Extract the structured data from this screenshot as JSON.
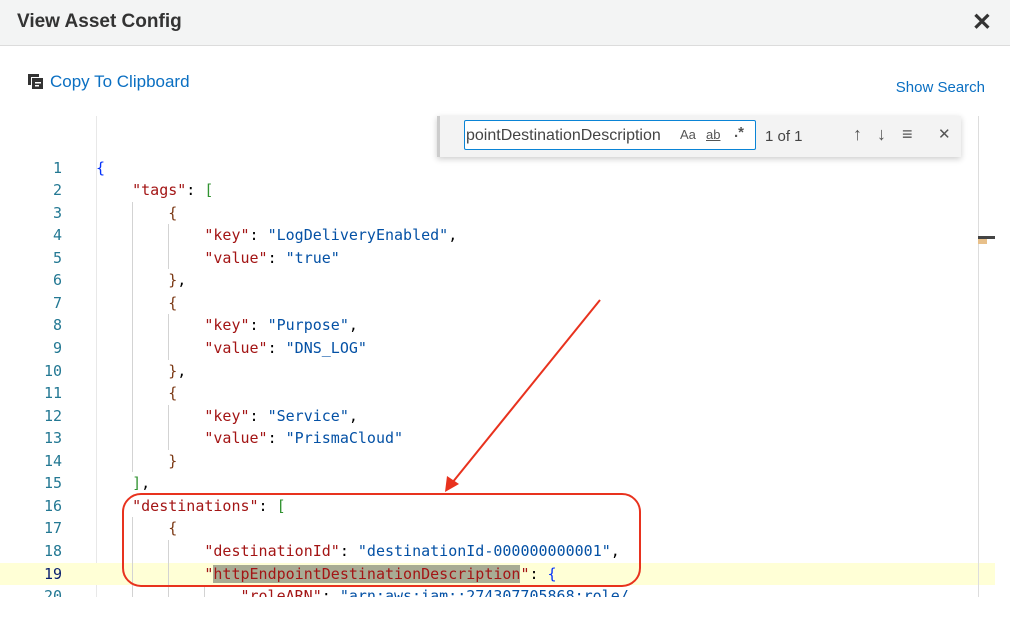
{
  "header": {
    "title": "View Asset Config",
    "close_icon": "close-icon"
  },
  "toolbar": {
    "copy_label": "Copy To Clipboard",
    "show_search_label": "Show Search"
  },
  "find": {
    "value": "pointDestinationDescription",
    "match_case": "Aa",
    "whole_word": "ab",
    "regex": ".*",
    "count": "1 of 1",
    "prev": "↑",
    "next": "↓",
    "selection": "≡",
    "close": "✕"
  },
  "editor": {
    "current_line": 19,
    "lines": [
      {
        "n": 1,
        "indent": 0,
        "t": [
          [
            "b1",
            "{"
          ]
        ]
      },
      {
        "n": 2,
        "indent": 1,
        "t": [
          [
            "k",
            "\"tags\""
          ],
          [
            "p",
            ": "
          ],
          [
            "b2",
            "["
          ]
        ]
      },
      {
        "n": 3,
        "indent": 2,
        "t": [
          [
            "b3",
            "{"
          ]
        ]
      },
      {
        "n": 4,
        "indent": 3,
        "t": [
          [
            "k",
            "\"key\""
          ],
          [
            "p",
            ": "
          ],
          [
            "s",
            "\"LogDeliveryEnabled\""
          ],
          [
            "p",
            ","
          ]
        ]
      },
      {
        "n": 5,
        "indent": 3,
        "t": [
          [
            "k",
            "\"value\""
          ],
          [
            "p",
            ": "
          ],
          [
            "s",
            "\"true\""
          ]
        ]
      },
      {
        "n": 6,
        "indent": 2,
        "t": [
          [
            "b3",
            "}"
          ],
          [
            "p",
            ","
          ]
        ]
      },
      {
        "n": 7,
        "indent": 2,
        "t": [
          [
            "b3",
            "{"
          ]
        ]
      },
      {
        "n": 8,
        "indent": 3,
        "t": [
          [
            "k",
            "\"key\""
          ],
          [
            "p",
            ": "
          ],
          [
            "s",
            "\"Purpose\""
          ],
          [
            "p",
            ","
          ]
        ]
      },
      {
        "n": 9,
        "indent": 3,
        "t": [
          [
            "k",
            "\"value\""
          ],
          [
            "p",
            ": "
          ],
          [
            "s",
            "\"DNS_LOG\""
          ]
        ]
      },
      {
        "n": 10,
        "indent": 2,
        "t": [
          [
            "b3",
            "}"
          ],
          [
            "p",
            ","
          ]
        ]
      },
      {
        "n": 11,
        "indent": 2,
        "t": [
          [
            "b3",
            "{"
          ]
        ]
      },
      {
        "n": 12,
        "indent": 3,
        "t": [
          [
            "k",
            "\"key\""
          ],
          [
            "p",
            ": "
          ],
          [
            "s",
            "\"Service\""
          ],
          [
            "p",
            ","
          ]
        ]
      },
      {
        "n": 13,
        "indent": 3,
        "t": [
          [
            "k",
            "\"value\""
          ],
          [
            "p",
            ": "
          ],
          [
            "s",
            "\"PrismaCloud\""
          ]
        ]
      },
      {
        "n": 14,
        "indent": 2,
        "t": [
          [
            "b3",
            "}"
          ]
        ]
      },
      {
        "n": 15,
        "indent": 1,
        "t": [
          [
            "b2",
            "]"
          ],
          [
            "p",
            ","
          ]
        ]
      },
      {
        "n": 16,
        "indent": 1,
        "t": [
          [
            "k",
            "\"destinations\""
          ],
          [
            "p",
            ": "
          ],
          [
            "b2",
            "["
          ]
        ]
      },
      {
        "n": 17,
        "indent": 2,
        "t": [
          [
            "b3",
            "{"
          ]
        ]
      },
      {
        "n": 18,
        "indent": 3,
        "t": [
          [
            "k",
            "\"destinationId\""
          ],
          [
            "p",
            ": "
          ],
          [
            "s",
            "\"destinationId-000000000001\""
          ],
          [
            "p",
            ","
          ]
        ]
      },
      {
        "n": 19,
        "indent": 3,
        "t": [
          [
            "k",
            "\""
          ],
          [
            "k hl",
            "httpEndpointDestinationDescription"
          ],
          [
            "k",
            "\""
          ],
          [
            "p",
            ": "
          ],
          [
            "b1",
            "{"
          ]
        ]
      },
      {
        "n": 20,
        "indent": 4,
        "t": [
          [
            "k",
            "\"roleARN\""
          ],
          [
            "p",
            ": "
          ],
          [
            "s",
            "\"arn:aws:iam::274307705868:role/"
          ]
        ]
      }
    ]
  },
  "colors": {
    "accent": "#0a6fc2",
    "annotation": "#e8321e",
    "current_line": "#ffffd6"
  }
}
